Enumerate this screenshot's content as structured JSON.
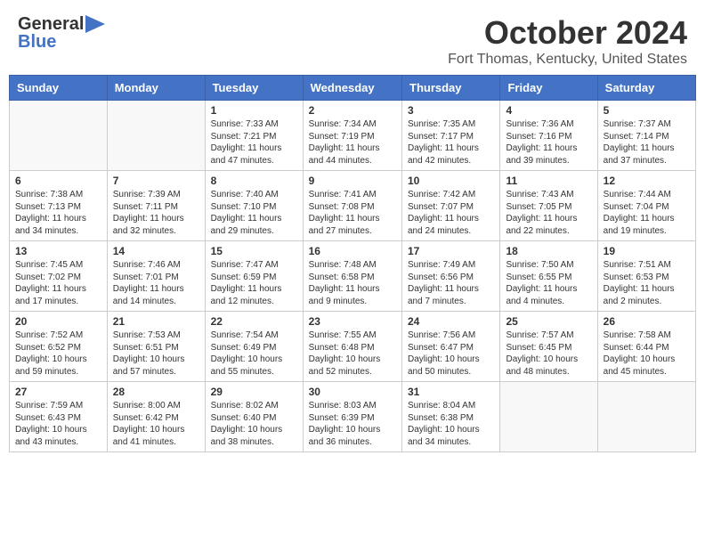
{
  "header": {
    "logo_line1": "General",
    "logo_line2": "Blue",
    "title": "October 2024",
    "subtitle": "Fort Thomas, Kentucky, United States"
  },
  "days_of_week": [
    "Sunday",
    "Monday",
    "Tuesday",
    "Wednesday",
    "Thursday",
    "Friday",
    "Saturday"
  ],
  "weeks": [
    [
      {
        "day": "",
        "sunrise": "",
        "sunset": "",
        "daylight": ""
      },
      {
        "day": "",
        "sunrise": "",
        "sunset": "",
        "daylight": ""
      },
      {
        "day": "1",
        "sunrise": "Sunrise: 7:33 AM",
        "sunset": "Sunset: 7:21 PM",
        "daylight": "Daylight: 11 hours and 47 minutes."
      },
      {
        "day": "2",
        "sunrise": "Sunrise: 7:34 AM",
        "sunset": "Sunset: 7:19 PM",
        "daylight": "Daylight: 11 hours and 44 minutes."
      },
      {
        "day": "3",
        "sunrise": "Sunrise: 7:35 AM",
        "sunset": "Sunset: 7:17 PM",
        "daylight": "Daylight: 11 hours and 42 minutes."
      },
      {
        "day": "4",
        "sunrise": "Sunrise: 7:36 AM",
        "sunset": "Sunset: 7:16 PM",
        "daylight": "Daylight: 11 hours and 39 minutes."
      },
      {
        "day": "5",
        "sunrise": "Sunrise: 7:37 AM",
        "sunset": "Sunset: 7:14 PM",
        "daylight": "Daylight: 11 hours and 37 minutes."
      }
    ],
    [
      {
        "day": "6",
        "sunrise": "Sunrise: 7:38 AM",
        "sunset": "Sunset: 7:13 PM",
        "daylight": "Daylight: 11 hours and 34 minutes."
      },
      {
        "day": "7",
        "sunrise": "Sunrise: 7:39 AM",
        "sunset": "Sunset: 7:11 PM",
        "daylight": "Daylight: 11 hours and 32 minutes."
      },
      {
        "day": "8",
        "sunrise": "Sunrise: 7:40 AM",
        "sunset": "Sunset: 7:10 PM",
        "daylight": "Daylight: 11 hours and 29 minutes."
      },
      {
        "day": "9",
        "sunrise": "Sunrise: 7:41 AM",
        "sunset": "Sunset: 7:08 PM",
        "daylight": "Daylight: 11 hours and 27 minutes."
      },
      {
        "day": "10",
        "sunrise": "Sunrise: 7:42 AM",
        "sunset": "Sunset: 7:07 PM",
        "daylight": "Daylight: 11 hours and 24 minutes."
      },
      {
        "day": "11",
        "sunrise": "Sunrise: 7:43 AM",
        "sunset": "Sunset: 7:05 PM",
        "daylight": "Daylight: 11 hours and 22 minutes."
      },
      {
        "day": "12",
        "sunrise": "Sunrise: 7:44 AM",
        "sunset": "Sunset: 7:04 PM",
        "daylight": "Daylight: 11 hours and 19 minutes."
      }
    ],
    [
      {
        "day": "13",
        "sunrise": "Sunrise: 7:45 AM",
        "sunset": "Sunset: 7:02 PM",
        "daylight": "Daylight: 11 hours and 17 minutes."
      },
      {
        "day": "14",
        "sunrise": "Sunrise: 7:46 AM",
        "sunset": "Sunset: 7:01 PM",
        "daylight": "Daylight: 11 hours and 14 minutes."
      },
      {
        "day": "15",
        "sunrise": "Sunrise: 7:47 AM",
        "sunset": "Sunset: 6:59 PM",
        "daylight": "Daylight: 11 hours and 12 minutes."
      },
      {
        "day": "16",
        "sunrise": "Sunrise: 7:48 AM",
        "sunset": "Sunset: 6:58 PM",
        "daylight": "Daylight: 11 hours and 9 minutes."
      },
      {
        "day": "17",
        "sunrise": "Sunrise: 7:49 AM",
        "sunset": "Sunset: 6:56 PM",
        "daylight": "Daylight: 11 hours and 7 minutes."
      },
      {
        "day": "18",
        "sunrise": "Sunrise: 7:50 AM",
        "sunset": "Sunset: 6:55 PM",
        "daylight": "Daylight: 11 hours and 4 minutes."
      },
      {
        "day": "19",
        "sunrise": "Sunrise: 7:51 AM",
        "sunset": "Sunset: 6:53 PM",
        "daylight": "Daylight: 11 hours and 2 minutes."
      }
    ],
    [
      {
        "day": "20",
        "sunrise": "Sunrise: 7:52 AM",
        "sunset": "Sunset: 6:52 PM",
        "daylight": "Daylight: 10 hours and 59 minutes."
      },
      {
        "day": "21",
        "sunrise": "Sunrise: 7:53 AM",
        "sunset": "Sunset: 6:51 PM",
        "daylight": "Daylight: 10 hours and 57 minutes."
      },
      {
        "day": "22",
        "sunrise": "Sunrise: 7:54 AM",
        "sunset": "Sunset: 6:49 PM",
        "daylight": "Daylight: 10 hours and 55 minutes."
      },
      {
        "day": "23",
        "sunrise": "Sunrise: 7:55 AM",
        "sunset": "Sunset: 6:48 PM",
        "daylight": "Daylight: 10 hours and 52 minutes."
      },
      {
        "day": "24",
        "sunrise": "Sunrise: 7:56 AM",
        "sunset": "Sunset: 6:47 PM",
        "daylight": "Daylight: 10 hours and 50 minutes."
      },
      {
        "day": "25",
        "sunrise": "Sunrise: 7:57 AM",
        "sunset": "Sunset: 6:45 PM",
        "daylight": "Daylight: 10 hours and 48 minutes."
      },
      {
        "day": "26",
        "sunrise": "Sunrise: 7:58 AM",
        "sunset": "Sunset: 6:44 PM",
        "daylight": "Daylight: 10 hours and 45 minutes."
      }
    ],
    [
      {
        "day": "27",
        "sunrise": "Sunrise: 7:59 AM",
        "sunset": "Sunset: 6:43 PM",
        "daylight": "Daylight: 10 hours and 43 minutes."
      },
      {
        "day": "28",
        "sunrise": "Sunrise: 8:00 AM",
        "sunset": "Sunset: 6:42 PM",
        "daylight": "Daylight: 10 hours and 41 minutes."
      },
      {
        "day": "29",
        "sunrise": "Sunrise: 8:02 AM",
        "sunset": "Sunset: 6:40 PM",
        "daylight": "Daylight: 10 hours and 38 minutes."
      },
      {
        "day": "30",
        "sunrise": "Sunrise: 8:03 AM",
        "sunset": "Sunset: 6:39 PM",
        "daylight": "Daylight: 10 hours and 36 minutes."
      },
      {
        "day": "31",
        "sunrise": "Sunrise: 8:04 AM",
        "sunset": "Sunset: 6:38 PM",
        "daylight": "Daylight: 10 hours and 34 minutes."
      },
      {
        "day": "",
        "sunrise": "",
        "sunset": "",
        "daylight": ""
      },
      {
        "day": "",
        "sunrise": "",
        "sunset": "",
        "daylight": ""
      }
    ]
  ]
}
